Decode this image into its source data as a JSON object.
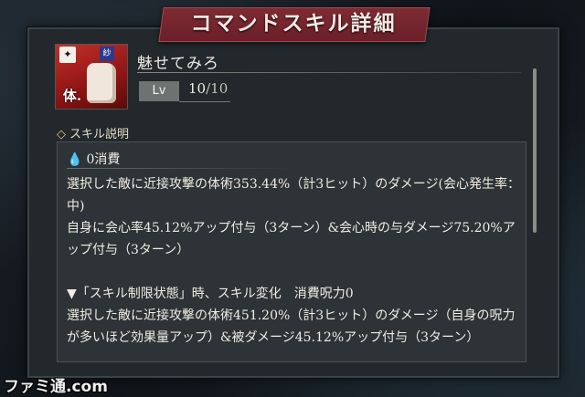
{
  "header": {
    "title": "コマンドスキル詳細"
  },
  "skill": {
    "name": "魅せてみろ",
    "level_label": "Lv",
    "level_current": "10",
    "level_max": "/10",
    "icon_badge": "体.",
    "icon_tag": "紗"
  },
  "section": {
    "title": "スキル説明"
  },
  "description": {
    "cost": "0消費",
    "text": "選択した敵に近接攻撃の体術353.44%（計3ヒット）のダメージ(会心発生率：中)\n自身に会心率45.12%アップ付与（3ターン）&会心時の与ダメージ75.20%アップ付与（3ターン）\n\n▼「スキル制限状態」時、スキル変化　消費呪力0\n選択した敵に近接攻撃の体術451.20%（計3ヒット）のダメージ（自身の呪力が多いほど効果量アップ）&被ダメージ45.12%アップ付与（3ターン）"
  },
  "watermark": "ファミ通.com"
}
